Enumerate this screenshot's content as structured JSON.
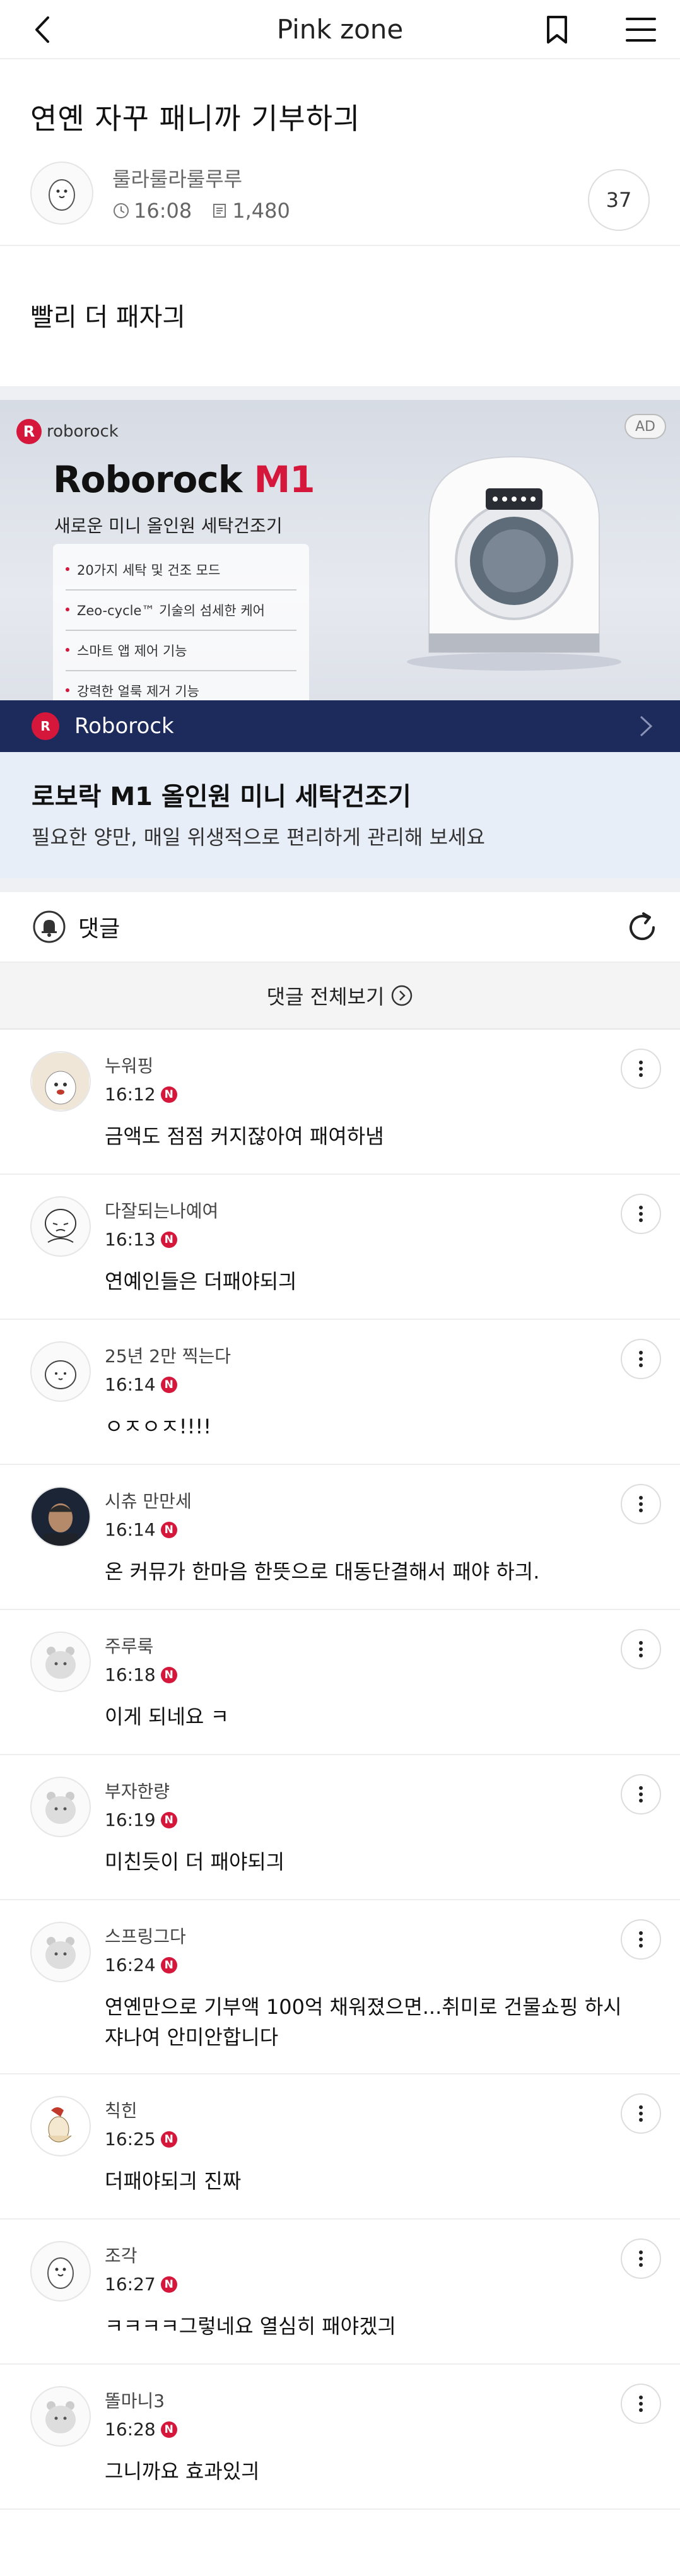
{
  "topbar": {
    "title": "Pink zone",
    "back_icon": "chevron-left-icon",
    "bookmark_icon": "bookmark-icon",
    "menu_icon": "hamburger-menu-icon"
  },
  "post": {
    "title": "연옌 자꾸 패니까 기부하긔",
    "author": "룰라룰라룰루루",
    "time": "16:08",
    "views": "1,480",
    "comment_count": "37",
    "body": "빨리 더 패자긔"
  },
  "ad": {
    "brand_top": "roborock",
    "badge": "AD",
    "product_name": "Roborock",
    "product_model": "M1",
    "subtitle": "새로운 미니 올인원 세탁건조기",
    "features": [
      "20가지 세탁 및 건조 모드",
      "Zeo-cycle™ 기술의 섬세한 케어",
      "스마트 앱 제어 기능",
      "강력한 얼룩 제거 기능"
    ],
    "brand_bar": "Roborock",
    "headline": "로보락 M1 올인원 미니 세탁건조기",
    "description": "필요한 양만, 매일 위생적으로 편리하게 관리해 보세요",
    "brand_color": "#d4173a"
  },
  "comments_section": {
    "label": "댓글",
    "view_all": "댓글 전체보기",
    "items": [
      {
        "name": "누워핑",
        "time": "16:12",
        "badge": "N",
        "text": "금액도 점점 커지잖아여 패여하냄"
      },
      {
        "name": "다잘되는나예여",
        "time": "16:13",
        "badge": "N",
        "text": "연예인들은 더패야되긔"
      },
      {
        "name": "25년 2만 찍는다",
        "time": "16:14",
        "badge": "N",
        "text": "ㅇㅈㅇㅈ!!!!"
      },
      {
        "name": "시츄 만만세",
        "time": "16:14",
        "badge": "N",
        "text": "온 커뮤가 한마음 한뜻으로 대동단결해서 패야 하긔."
      },
      {
        "name": "주루룩",
        "time": "16:18",
        "badge": "N",
        "text": "이게 되네요 ㅋ"
      },
      {
        "name": "부자한량",
        "time": "16:19",
        "badge": "N",
        "text": "미친듯이 더 패야되긔"
      },
      {
        "name": "스프링그다",
        "time": "16:24",
        "badge": "N",
        "text": "연옌만으로 기부액 100억 채워졌으면...취미로 건물쇼핑 하시쟈나여 안미안합니다"
      },
      {
        "name": "칙힌",
        "time": "16:25",
        "badge": "N",
        "text": "더패야되긔 진짜"
      },
      {
        "name": "조각",
        "time": "16:27",
        "badge": "N",
        "text": "ㅋㅋㅋㅋ그렇네요 열심히 패야겠긔"
      },
      {
        "name": "똘마니3",
        "time": "16:28",
        "badge": "N",
        "text": "그니까요 효과있긔"
      }
    ]
  }
}
